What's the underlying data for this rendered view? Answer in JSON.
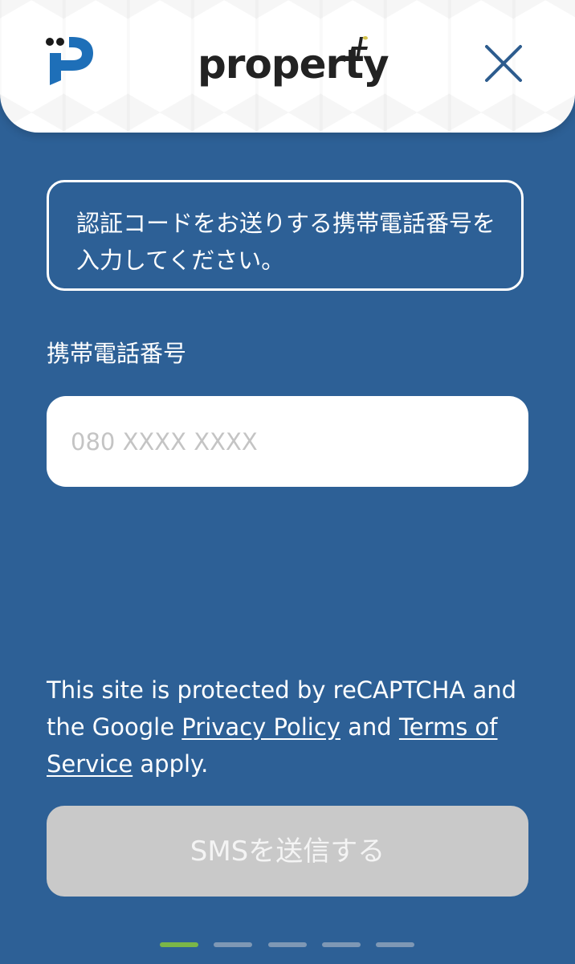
{
  "header": {
    "brand_name": "property",
    "close_icon": "close-icon",
    "logo_icon": "property-p-logo-icon",
    "plus_icon": "plus-icon",
    "colors": {
      "logo_blue": "#1e6fb8",
      "plus_yellow": "#d4c24a",
      "close_blue": "#2d5c8e"
    }
  },
  "form": {
    "notice_text": "認証コードをお送りする携帯電話番号を入力してください。",
    "phone_label": "携帯電話番号",
    "phone_placeholder": "080 XXXX XXXX",
    "phone_value": ""
  },
  "recaptcha": {
    "text_before": "This site is protected by reCAPTCHA and the Google ",
    "privacy_link": "Privacy Policy",
    "text_and": " and ",
    "terms_link": "Terms of Service",
    "text_after": " apply."
  },
  "actions": {
    "submit_label": "SMSを送信する"
  },
  "progress": {
    "current_step": 1,
    "total_steps": 5,
    "active_color": "#7ab648",
    "inactive_color": "#7e98b5"
  },
  "theme": {
    "background": "#2d6096"
  }
}
